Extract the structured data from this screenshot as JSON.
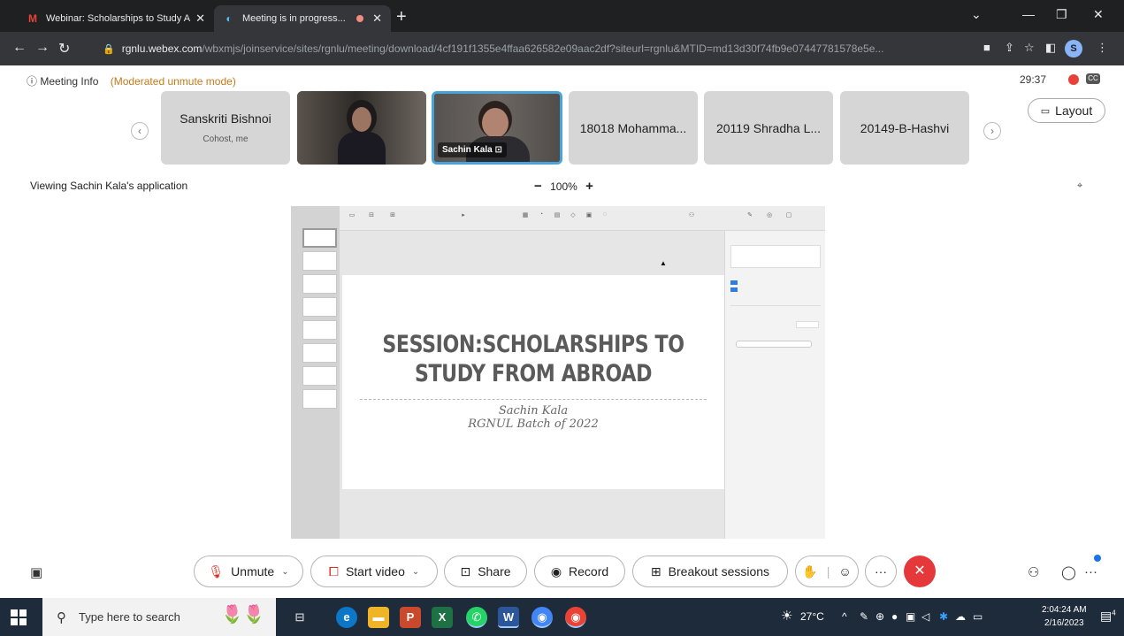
{
  "browser": {
    "tabs": [
      {
        "title": "Webinar: Scholarships to Study A",
        "favicon": "gmail-icon",
        "close": "✕"
      },
      {
        "title": "Meeting is in progress...",
        "favicon": "webex-icon",
        "close": "✕"
      }
    ],
    "new_tab": "+",
    "url_host": "rgnlu.webex.com",
    "url_path": "/wbxmjs/joinservice/sites/rgnlu/meeting/download/4cf191f1355e4ffaa626582e09aac2df?siteurl=rgnlu&MTID=md13d30f74fb9e07447781578e5e...",
    "profile_initial": "S"
  },
  "meeting": {
    "info_label": "Meeting Info",
    "mode": "(Moderated unmute mode)",
    "timer": "29:37",
    "participants": [
      {
        "name": "Sanskriti Bishnoi",
        "role": "Cohost, me",
        "video": false
      },
      {
        "name": "",
        "role": "",
        "video": true
      },
      {
        "name": "Sachin Kala",
        "role": "",
        "video": true,
        "active": true
      },
      {
        "name": "18018 Mohamma...",
        "role": "",
        "video": false
      },
      {
        "name": "20119 Shradha L...",
        "role": "",
        "video": false
      },
      {
        "name": "20149-B-Hashvi",
        "role": "",
        "video": false
      }
    ],
    "layout_label": "Layout",
    "viewing": "Viewing Sachin Kala's application",
    "zoom_minus": "−",
    "zoom_level": "100%",
    "zoom_plus": "+"
  },
  "slide": {
    "title_line1": "SESSION:SCHOLARSHIPS TO",
    "title_line2": "STUDY FROM ABROAD",
    "subtitle_line1": "Sachin Kala",
    "subtitle_line2": "RGNUL Batch of 2022"
  },
  "controls": {
    "unmute": "Unmute",
    "start_video": "Start video",
    "share": "Share",
    "record": "Record",
    "breakout": "Breakout sessions",
    "more": "···"
  },
  "taskbar": {
    "search_placeholder": "Type here to search",
    "weather": "27°C",
    "time": "2:04:24 AM",
    "date": "2/16/2023",
    "notif_count": "4"
  }
}
